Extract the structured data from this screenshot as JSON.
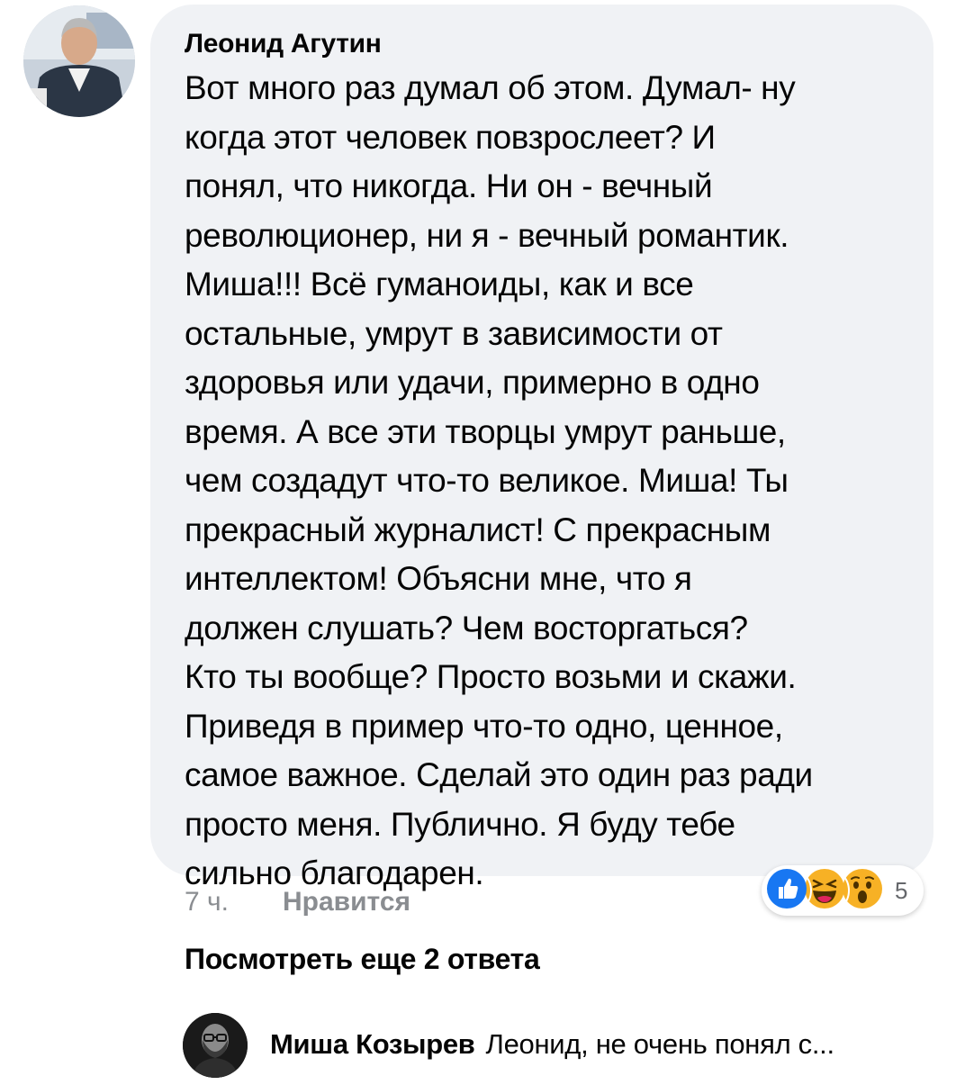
{
  "comment": {
    "author": "Леонид Агутин",
    "text": "Вот много раз думал об этом. Думал- ну\nкогда этот человек повзрослеет? И\nпонял, что никогда. Ни он - вечный\nреволюционер, ни я - вечный романтик.\nМиша!!! Всё гуманоиды, как и все\nостальные, умрут в зависимости от\nздоровья или удачи, примерно в одно\nвремя. А все эти творцы умрут раньше,\nчем создадут что-то великое. Миша! Ты\nпрекрасный журналист! С прекрасным\nинтеллектом! Объясни мне, что я\nдолжен слушать? Чем восторгаться?\nКто ты вообще? Просто возьми и скажи.\nПриведя в пример что-то одно, ценное,\nсамое важное. Сделай это один раз ради\nпросто меня. Публично. Я буду тебе\nсильно благодарен.",
    "time": "7 ч.",
    "like_label": "Нравится",
    "reactions": {
      "icons": [
        "like-icon",
        "laugh-icon",
        "wow-icon"
      ],
      "count": "5"
    }
  },
  "more_replies_label": "Посмотреть еще 2 ответа",
  "reply": {
    "author": "Миша Козырев",
    "text": "Леонид, не очень понял с..."
  },
  "colors": {
    "bubble_bg": "#f0f2f5",
    "like_blue": "#1877f2",
    "reaction_yellow": "#f7b125",
    "meta_gray": "#8a8d91"
  }
}
